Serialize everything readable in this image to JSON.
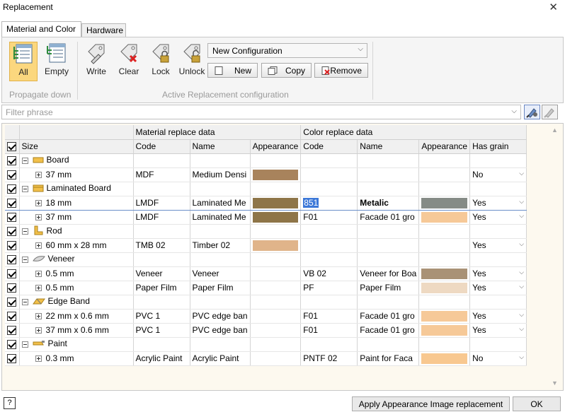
{
  "window": {
    "title": "Replacement",
    "close_glyph": "✕"
  },
  "tabs": [
    {
      "label": "Material and Color",
      "active": true
    },
    {
      "label": "Hardware",
      "active": false
    }
  ],
  "ribbon": {
    "propagate": {
      "all_label": "All",
      "empty_label": "Empty",
      "group_label": "Propagate down"
    },
    "actions": {
      "write_label": "Write",
      "clear_label": "Clear",
      "lock_label": "Lock",
      "unlock_label": "Unlock"
    },
    "config_select": "New Configuration",
    "new_label": "New",
    "copy_label": "Copy",
    "remove_label": "Remove",
    "group_label": "Active Replacement configuration"
  },
  "filter": {
    "placeholder": "Filter phrase"
  },
  "grid": {
    "group_headers": {
      "material": "Material replace data",
      "color": "Color replace data"
    },
    "columns": [
      "Size",
      "Code",
      "Name",
      "Appearance",
      "Code",
      "Name",
      "Appearance",
      "Has grain"
    ],
    "rows": [
      {
        "type": "group",
        "label": "Board",
        "icon": "board-icon"
      },
      {
        "type": "item",
        "size": "37 mm",
        "mat_code": "MDF",
        "mat_name": "Medium Densi",
        "mat_swatch": "#a8835c",
        "col_code": "",
        "col_name": "",
        "col_swatch": "",
        "grain": "No"
      },
      {
        "type": "group",
        "label": "Laminated Board",
        "icon": "laminated-board-icon"
      },
      {
        "type": "item",
        "size": "18 mm",
        "mat_code": "LMDF",
        "mat_name": "Laminated Me",
        "mat_swatch": "#8e7548",
        "col_code": "851",
        "col_name": "Metalic",
        "col_swatch": "#858b86",
        "grain": "Yes",
        "selected": true
      },
      {
        "type": "item",
        "size": "37 mm",
        "mat_code": "LMDF",
        "mat_name": "Laminated Me",
        "mat_swatch": "#8e7548",
        "col_code": "F01",
        "col_name": "Facade 01 gro",
        "col_swatch": "#f6c998",
        "grain": "Yes"
      },
      {
        "type": "group",
        "label": "Rod",
        "icon": "rod-icon"
      },
      {
        "type": "item",
        "size": "60 mm x 28 mm",
        "mat_code": "TMB 02",
        "mat_name": "Timber 02",
        "mat_swatch": "#e0b48a",
        "col_code": "",
        "col_name": "",
        "col_swatch": "",
        "grain": "Yes"
      },
      {
        "type": "group",
        "label": "Veneer",
        "icon": "veneer-icon"
      },
      {
        "type": "item",
        "size": "0.5 mm",
        "mat_code": "Veneer",
        "mat_name": "Veneer",
        "mat_swatch": "",
        "col_code": "VB 02",
        "col_name": "Veneer for Boa",
        "col_swatch": "#a99276",
        "grain": "Yes"
      },
      {
        "type": "item",
        "size": "0.5 mm",
        "mat_code": "Paper Film",
        "mat_name": "Paper Film",
        "mat_swatch": "",
        "col_code": "PF",
        "col_name": "Paper Film",
        "col_swatch": "#eed9c2",
        "grain": "Yes"
      },
      {
        "type": "group",
        "label": "Edge Band",
        "icon": "edge-band-icon"
      },
      {
        "type": "item",
        "size": "22 mm x 0.6 mm",
        "mat_code": "PVC 1",
        "mat_name": "PVC edge ban",
        "mat_swatch": "",
        "col_code": "F01",
        "col_name": "Facade 01 gro",
        "col_swatch": "#f6c998",
        "grain": "Yes"
      },
      {
        "type": "item",
        "size": "37 mm x 0.6 mm",
        "mat_code": "PVC 1",
        "mat_name": "PVC edge ban",
        "mat_swatch": "",
        "col_code": "F01",
        "col_name": "Facade 01 gro",
        "col_swatch": "#f6c998",
        "grain": "Yes"
      },
      {
        "type": "group",
        "label": "Paint",
        "icon": "paint-icon"
      },
      {
        "type": "item",
        "size": "0.3 mm",
        "mat_code": "Acrylic Paint",
        "mat_name": "Acrylic Paint",
        "mat_swatch": "",
        "col_code": "PNTF 02",
        "col_name": "Paint for Faca",
        "col_swatch": "#f8c890",
        "grain": "No"
      }
    ]
  },
  "footer": {
    "help_label": "?",
    "apply_label": "Apply Appearance Image replacement",
    "ok_label": "OK"
  }
}
